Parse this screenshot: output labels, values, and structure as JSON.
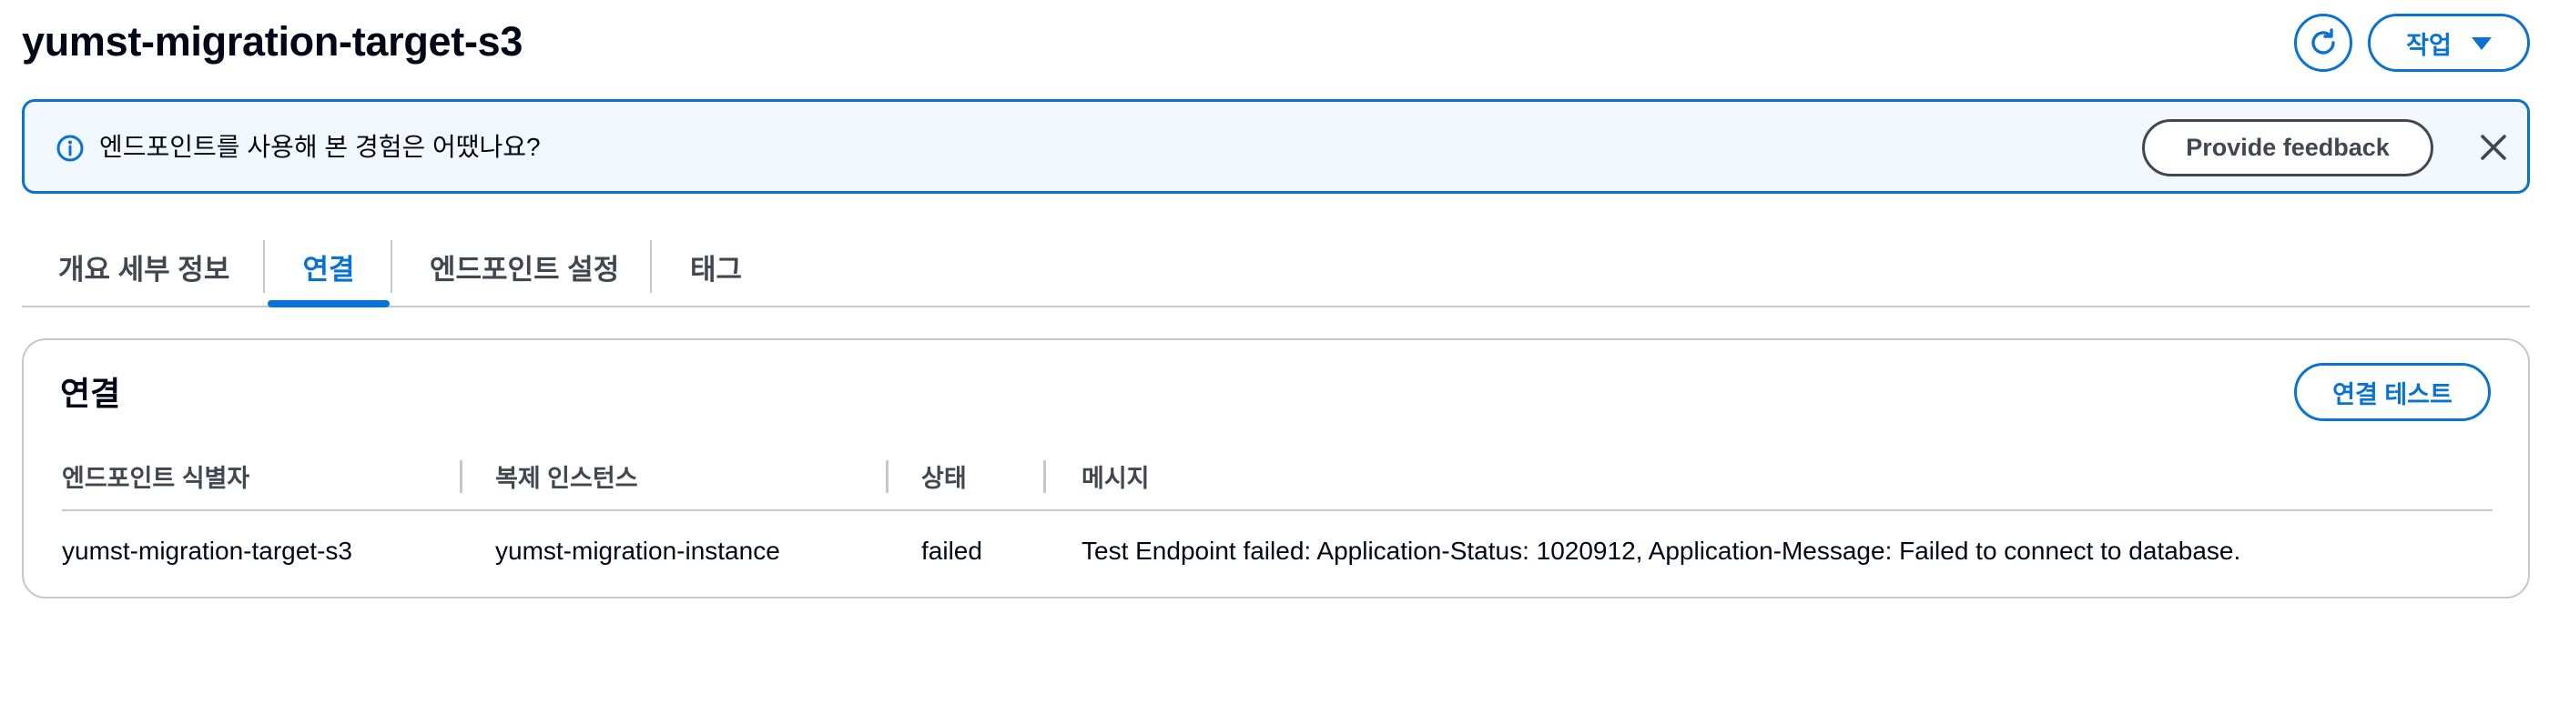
{
  "header": {
    "title": "yumst-migration-target-s3",
    "refresh_icon": "refresh-icon",
    "actions_label": "작업",
    "actions_icon": "caret-down-icon"
  },
  "flashbar": {
    "icon": "info-icon",
    "message": "엔드포인트를 사용해 본 경험은 어땠나요?",
    "feedback_label": "Provide feedback",
    "close_icon": "close-icon"
  },
  "tabs": [
    {
      "label": "개요 세부 정보",
      "active": false
    },
    {
      "label": "연결",
      "active": true
    },
    {
      "label": "엔드포인트 설정",
      "active": false
    },
    {
      "label": "태그",
      "active": false
    }
  ],
  "connections": {
    "title": "연결",
    "test_button_label": "연결 테스트",
    "columns": [
      "엔드포인트 식별자",
      "복제 인스턴스",
      "상태",
      "메시지"
    ],
    "rows": [
      [
        "yumst-migration-target-s3",
        "yumst-migration-instance",
        "failed",
        "Test Endpoint failed: Application-Status: 1020912, Application-Message: Failed to connect to database."
      ]
    ]
  },
  "colors": {
    "accent": "#0972d3",
    "info_background": "#f2f8fd",
    "border": "#c6c6cd",
    "text": "#000716",
    "secondary_text": "#424650"
  }
}
